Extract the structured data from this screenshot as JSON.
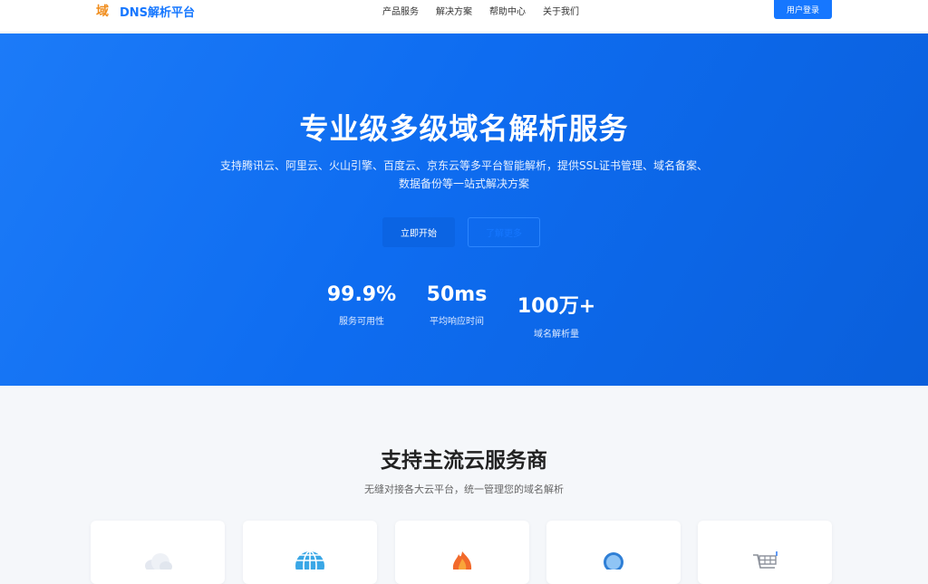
{
  "header": {
    "logo_icon": "域",
    "logo_text": "DNS解析平台",
    "nav": [
      "产品服务",
      "解决方案",
      "帮助中心",
      "关于我们"
    ],
    "login_label": "用户登录"
  },
  "hero": {
    "title": "专业级多级域名解析服务",
    "subtitle_line1": "支持腾讯云、阿里云、火山引擎、百度云、京东云等多平台智能解析，提供SSL证书管理、域名备案、",
    "subtitle_line2": "数据备份等一站式解决方案",
    "primary_label": "立即开始",
    "secondary_label": "了解更多",
    "stats": [
      {
        "value": "99.9%",
        "label": "服务可用性"
      },
      {
        "value": "50ms",
        "label": "平均响应时间"
      },
      {
        "value": "100万+",
        "label": "域名解析量"
      }
    ]
  },
  "providers": {
    "title": "支持主流云服务商",
    "subtitle": "无缝对接各大云平台，统一管理您的域名解析",
    "cards": [
      {
        "icon": "cloud-icon"
      },
      {
        "icon": "globe-icon"
      },
      {
        "icon": "flame-icon"
      },
      {
        "icon": "magnifier-icon"
      },
      {
        "icon": "cart-icon"
      }
    ]
  },
  "colors": {
    "brand": "#1677ff",
    "logo_accent": "#f08c1a",
    "hero_gradient_start": "#1c7bf8",
    "hero_gradient_end": "#0a5fdb"
  }
}
